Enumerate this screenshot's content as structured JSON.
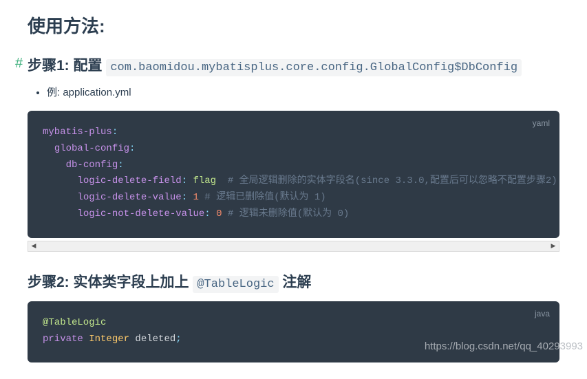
{
  "title": "使用方法:",
  "step1": {
    "anchor": "#",
    "prefix": "步骤1: 配置 ",
    "code": "com.baomidou.mybatisplus.core.config.GlobalConfig$DbConfig",
    "bullet": "例: application.yml"
  },
  "yamlBlock": {
    "lang": "yaml",
    "l1_key": "mybatis-plus",
    "l1_colon": ":",
    "l2_key": "global-config",
    "l2_colon": ":",
    "l3_key": "db-config",
    "l3_colon": ":",
    "l4_key": "logic-delete-field",
    "l4_colon": ": ",
    "l4_val": "flag",
    "l4_cmt": "  # 全局逻辑删除的实体字段名(since 3.3.0,配置后可以忽略不配置步骤2)",
    "l5_key": "logic-delete-value",
    "l5_colon": ": ",
    "l5_val": "1",
    "l5_cmt": " # 逻辑已删除值(默认为 1)",
    "l6_key": "logic-not-delete-value",
    "l6_colon": ": ",
    "l6_val": "0",
    "l6_cmt": " # 逻辑未删除值(默认为 0)"
  },
  "scrollbar": {
    "left": "◀",
    "right": "▶"
  },
  "step2": {
    "prefix": "步骤2: 实体类字段上加上 ",
    "code": "@TableLogic",
    "suffix": " 注解"
  },
  "javaBlock": {
    "lang": "java",
    "ann": "@TableLogic",
    "kw": "private",
    "type": "Integer",
    "field": " deleted",
    "semi": ";"
  },
  "watermark": "https://blog.csdn.net/qq_40293993"
}
